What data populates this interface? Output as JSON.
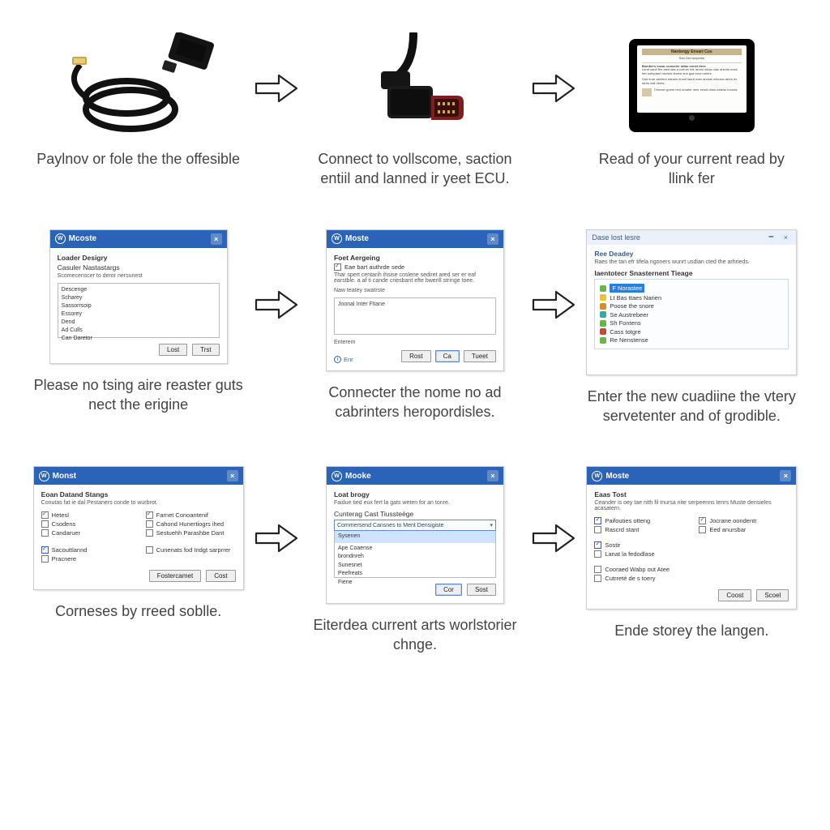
{
  "row1": {
    "step1_caption": "Paylnov or fole the the offesible",
    "step2_caption": "Connect to vollscome, saction entiil and lanned ir yeet ECU.",
    "step3_caption": "Read of your current read by llink fer",
    "tablet_title": "Nantengy Ensart Cus"
  },
  "row2": {
    "step1": {
      "title": "Mcoste",
      "section": "Loader Desigry",
      "subsection": "Casuler Nastastargs",
      "hint": "Scomecenscer to deror nersunest",
      "list": [
        "Descenge",
        "Scharey",
        "Sassorrsoip",
        "Essorey",
        "Dend",
        "Ad Culls",
        "Can Daretor"
      ],
      "btn1": "Lost",
      "btn2": "Trst",
      "caption": "Please no tsing aire reaster guts nect the erigine"
    },
    "step2": {
      "title": "Moste",
      "section": "Foet Aergeing",
      "hint1": "Eae bart authrde sede",
      "desc": "Thar spert centarih ihsise coslene sediret ared ser er eaf earstble. a af ti cande criesbant efte bwerill stringe toee.",
      "hint2": "Naw teatey swatrste",
      "textbox": "Joonal Inter Ftiane",
      "footer_label": "Enterem",
      "btn1": "Rost",
      "btn2": "Ca",
      "btn3": "Tueet",
      "mini": "Enr",
      "caption": "Connecter the nome no ad cabrinters heropordisles."
    },
    "step3": {
      "title": "Dase lost lesre",
      "head": "Ree Deadey",
      "sub": "Raes the tan efr tifela ngoners wunrt usdian cted the arhrieds.",
      "section": "Iaentotecr Snasternent Tieage",
      "items": [
        {
          "c": "green",
          "t": "F Norastee",
          "sel": true
        },
        {
          "c": "yellow",
          "t": "Lt Bas ttaes Narien"
        },
        {
          "c": "orange",
          "t": "Poose the snore"
        },
        {
          "c": "teal",
          "t": "Se Austrebeer"
        },
        {
          "c": "green",
          "t": "Sh Fontens"
        },
        {
          "c": "red",
          "t": "Cass totgre"
        },
        {
          "c": "green",
          "t": "Re Nenstense"
        }
      ],
      "caption": "Enter the new cuadiine the vtery servetenter and of grodible."
    }
  },
  "row3": {
    "step1": {
      "title": "Monst",
      "section": "Eoan Datand Stangs",
      "hint": "Conutas fat ie dal Pestaners conde to wurbrot.",
      "left": [
        {
          "t": "Hetesl",
          "c": true
        },
        {
          "t": "Csodens",
          "c": false
        },
        {
          "t": "Candaruer",
          "c": false
        }
      ],
      "left2": [
        {
          "t": "Sacouttlannd",
          "c": true,
          "blue": true
        },
        {
          "t": "Pracnere",
          "c": false
        }
      ],
      "right": [
        {
          "t": "Farnet Conoantenif",
          "c": true
        },
        {
          "t": "Cahond Hunertiogrs ihed",
          "c": false
        },
        {
          "t": "Sestuehh Parashbe Dant",
          "c": false
        }
      ],
      "right2": [
        {
          "t": "Cunenats fod Indgt sarprrer",
          "c": false
        }
      ],
      "btn1": "Fostercamet",
      "btn2": "Cost",
      "caption": "Corneses by rreed soblle."
    },
    "step2": {
      "title": "Mooke",
      "section": "Loat brogy",
      "hint": "Faidue tied eux fert la gats weten for an tonre.",
      "sub2": "Cunterag Cast Tiussteège",
      "selected": "Commersend Cansnes to Ment Densigiste",
      "options": [
        "Sysenen",
        "Ape Coaense",
        "brondnreh",
        "Sunesnet",
        "Peefreats",
        "Fiene"
      ],
      "btn1": "Cor",
      "btn2": "Sost",
      "caption": "Eiterdea current arts worlstorier chnge."
    },
    "step3": {
      "title": "Moste",
      "section": "Eaas Tost",
      "hint": "Ceander is oey tae nith fil tnursa nite serpeenns tenrs Muste densieles acasatern.",
      "left": [
        {
          "t": "Paifouties otteng",
          "c": true,
          "blue": true
        },
        {
          "t": "Rascrd stant",
          "c": false
        }
      ],
      "left2": [
        {
          "t": "Sostir",
          "c": true,
          "blue": true
        },
        {
          "t": "Lanat la fedodlase",
          "c": false
        }
      ],
      "left3": [
        {
          "t": "Cooraed Wabp out Atee",
          "c": false
        },
        {
          "t": "Cutrreté de s toery",
          "c": false
        }
      ],
      "right": [
        {
          "t": "Jocrane oondentr",
          "c": true
        },
        {
          "t": "Eed anursbar",
          "c": false
        }
      ],
      "btn1": "Coost",
      "btn2": "Scoel",
      "caption": "Ende storey the langen."
    }
  }
}
